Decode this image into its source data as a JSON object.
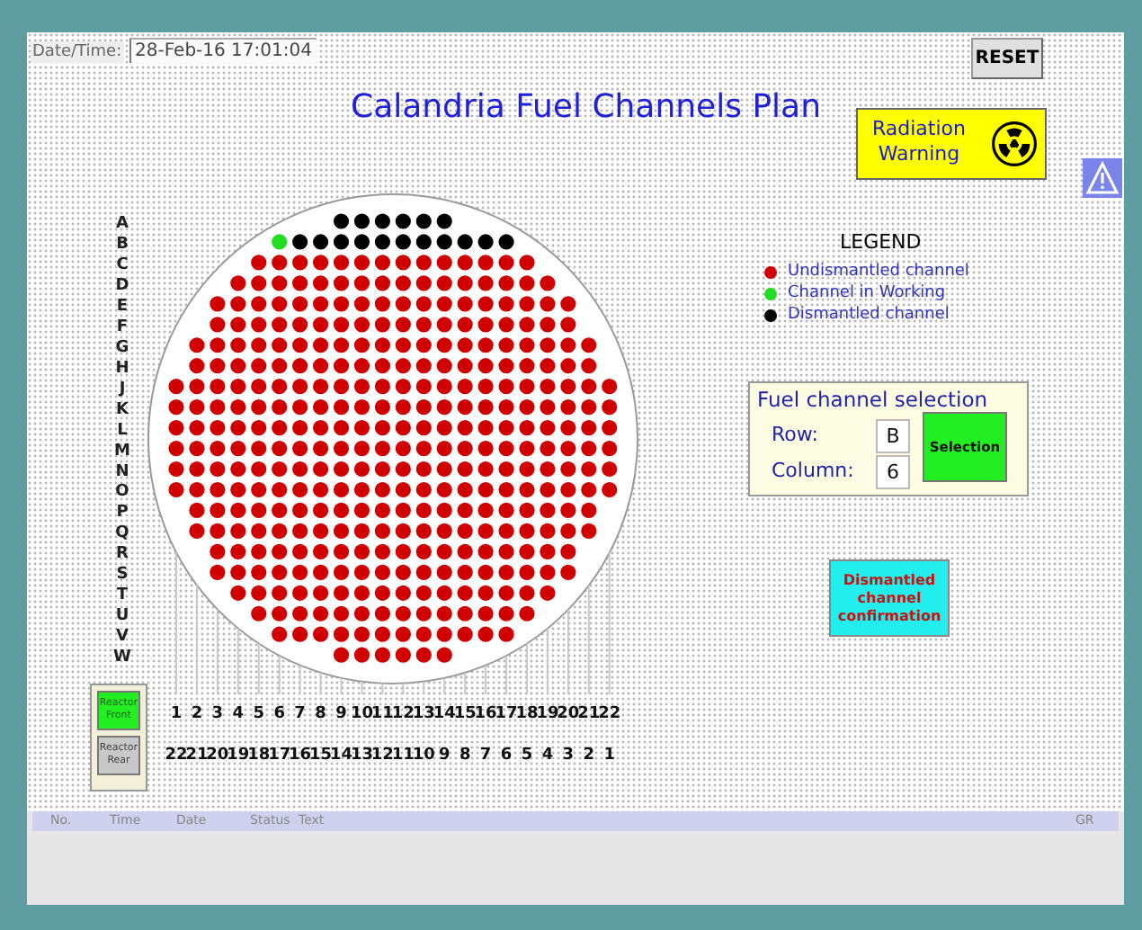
{
  "header": {
    "datetime_label": "Date/Time:",
    "datetime_value": "28-Feb-16 17:01:04",
    "reset_button": "RESET"
  },
  "title": "Calandria Fuel Channels Plan",
  "radiation_warning": {
    "text_line1": "Radiation",
    "text_line2": "Warning"
  },
  "grid": {
    "rows": [
      {
        "label": "A",
        "channels": [
          {
            "kind": "dismantled"
          },
          {
            "kind": "dismantled"
          },
          {
            "kind": "dismantled"
          },
          {
            "kind": "dismantled"
          },
          {
            "kind": "dismantled"
          },
          {
            "kind": "dismantled"
          }
        ]
      },
      {
        "label": "B",
        "channels": [
          {
            "kind": "working"
          },
          {
            "kind": "dismantled"
          },
          {
            "kind": "dismantled"
          },
          {
            "kind": "dismantled"
          },
          {
            "kind": "dismantled"
          },
          {
            "kind": "dismantled"
          },
          {
            "kind": "dismantled"
          },
          {
            "kind": "dismantled"
          },
          {
            "kind": "dismantled"
          },
          {
            "kind": "dismantled"
          },
          {
            "kind": "dismantled"
          },
          {
            "kind": "dismantled"
          }
        ]
      },
      {
        "label": "C",
        "channels": [
          {
            "kind": "intact"
          },
          {
            "kind": "intact"
          },
          {
            "kind": "intact"
          },
          {
            "kind": "intact"
          },
          {
            "kind": "intact"
          },
          {
            "kind": "intact"
          },
          {
            "kind": "intact"
          },
          {
            "kind": "intact"
          },
          {
            "kind": "intact"
          },
          {
            "kind": "intact"
          },
          {
            "kind": "intact"
          },
          {
            "kind": "intact"
          },
          {
            "kind": "intact"
          },
          {
            "kind": "intact"
          }
        ]
      },
      {
        "label": "D",
        "channels": [
          {
            "kind": "intact"
          },
          {
            "kind": "intact"
          },
          {
            "kind": "intact"
          },
          {
            "kind": "intact"
          },
          {
            "kind": "intact"
          },
          {
            "kind": "intact"
          },
          {
            "kind": "intact"
          },
          {
            "kind": "intact"
          },
          {
            "kind": "intact"
          },
          {
            "kind": "intact"
          },
          {
            "kind": "intact"
          },
          {
            "kind": "intact"
          },
          {
            "kind": "intact"
          },
          {
            "kind": "intact"
          },
          {
            "kind": "intact"
          },
          {
            "kind": "intact"
          }
        ]
      },
      {
        "label": "E",
        "channels": [
          {
            "kind": "intact"
          },
          {
            "kind": "intact"
          },
          {
            "kind": "intact"
          },
          {
            "kind": "intact"
          },
          {
            "kind": "intact"
          },
          {
            "kind": "intact"
          },
          {
            "kind": "intact"
          },
          {
            "kind": "intact"
          },
          {
            "kind": "intact"
          },
          {
            "kind": "intact"
          },
          {
            "kind": "intact"
          },
          {
            "kind": "intact"
          },
          {
            "kind": "intact"
          },
          {
            "kind": "intact"
          },
          {
            "kind": "intact"
          },
          {
            "kind": "intact"
          },
          {
            "kind": "intact"
          },
          {
            "kind": "intact"
          }
        ]
      },
      {
        "label": "F",
        "channels": [
          {
            "kind": "intact"
          },
          {
            "kind": "intact"
          },
          {
            "kind": "intact"
          },
          {
            "kind": "intact"
          },
          {
            "kind": "intact"
          },
          {
            "kind": "intact"
          },
          {
            "kind": "intact"
          },
          {
            "kind": "intact"
          },
          {
            "kind": "intact"
          },
          {
            "kind": "intact"
          },
          {
            "kind": "intact"
          },
          {
            "kind": "intact"
          },
          {
            "kind": "intact"
          },
          {
            "kind": "intact"
          },
          {
            "kind": "intact"
          },
          {
            "kind": "intact"
          },
          {
            "kind": "intact"
          },
          {
            "kind": "intact"
          }
        ]
      },
      {
        "label": "G",
        "channels": [
          {
            "kind": "intact"
          },
          {
            "kind": "intact"
          },
          {
            "kind": "intact"
          },
          {
            "kind": "intact"
          },
          {
            "kind": "intact"
          },
          {
            "kind": "intact"
          },
          {
            "kind": "intact"
          },
          {
            "kind": "intact"
          },
          {
            "kind": "intact"
          },
          {
            "kind": "intact"
          },
          {
            "kind": "intact"
          },
          {
            "kind": "intact"
          },
          {
            "kind": "intact"
          },
          {
            "kind": "intact"
          },
          {
            "kind": "intact"
          },
          {
            "kind": "intact"
          },
          {
            "kind": "intact"
          },
          {
            "kind": "intact"
          },
          {
            "kind": "intact"
          },
          {
            "kind": "intact"
          }
        ]
      },
      {
        "label": "H",
        "channels": [
          {
            "kind": "intact"
          },
          {
            "kind": "intact"
          },
          {
            "kind": "intact"
          },
          {
            "kind": "intact"
          },
          {
            "kind": "intact"
          },
          {
            "kind": "intact"
          },
          {
            "kind": "intact"
          },
          {
            "kind": "intact"
          },
          {
            "kind": "intact"
          },
          {
            "kind": "intact"
          },
          {
            "kind": "intact"
          },
          {
            "kind": "intact"
          },
          {
            "kind": "intact"
          },
          {
            "kind": "intact"
          },
          {
            "kind": "intact"
          },
          {
            "kind": "intact"
          },
          {
            "kind": "intact"
          },
          {
            "kind": "intact"
          },
          {
            "kind": "intact"
          },
          {
            "kind": "intact"
          }
        ]
      },
      {
        "label": "J",
        "channels": [
          {
            "kind": "intact"
          },
          {
            "kind": "intact"
          },
          {
            "kind": "intact"
          },
          {
            "kind": "intact"
          },
          {
            "kind": "intact"
          },
          {
            "kind": "intact"
          },
          {
            "kind": "intact"
          },
          {
            "kind": "intact"
          },
          {
            "kind": "intact"
          },
          {
            "kind": "intact"
          },
          {
            "kind": "intact"
          },
          {
            "kind": "intact"
          },
          {
            "kind": "intact"
          },
          {
            "kind": "intact"
          },
          {
            "kind": "intact"
          },
          {
            "kind": "intact"
          },
          {
            "kind": "intact"
          },
          {
            "kind": "intact"
          },
          {
            "kind": "intact"
          },
          {
            "kind": "intact"
          },
          {
            "kind": "intact"
          },
          {
            "kind": "intact"
          }
        ]
      },
      {
        "label": "K",
        "channels": [
          {
            "kind": "intact"
          },
          {
            "kind": "intact"
          },
          {
            "kind": "intact"
          },
          {
            "kind": "intact"
          },
          {
            "kind": "intact"
          },
          {
            "kind": "intact"
          },
          {
            "kind": "intact"
          },
          {
            "kind": "intact"
          },
          {
            "kind": "intact"
          },
          {
            "kind": "intact"
          },
          {
            "kind": "intact"
          },
          {
            "kind": "intact"
          },
          {
            "kind": "intact"
          },
          {
            "kind": "intact"
          },
          {
            "kind": "intact"
          },
          {
            "kind": "intact"
          },
          {
            "kind": "intact"
          },
          {
            "kind": "intact"
          },
          {
            "kind": "intact"
          },
          {
            "kind": "intact"
          },
          {
            "kind": "intact"
          },
          {
            "kind": "intact"
          }
        ]
      },
      {
        "label": "L",
        "channels": [
          {
            "kind": "intact"
          },
          {
            "kind": "intact"
          },
          {
            "kind": "intact"
          },
          {
            "kind": "intact"
          },
          {
            "kind": "intact"
          },
          {
            "kind": "intact"
          },
          {
            "kind": "intact"
          },
          {
            "kind": "intact"
          },
          {
            "kind": "intact"
          },
          {
            "kind": "intact"
          },
          {
            "kind": "intact"
          },
          {
            "kind": "intact"
          },
          {
            "kind": "intact"
          },
          {
            "kind": "intact"
          },
          {
            "kind": "intact"
          },
          {
            "kind": "intact"
          },
          {
            "kind": "intact"
          },
          {
            "kind": "intact"
          },
          {
            "kind": "intact"
          },
          {
            "kind": "intact"
          },
          {
            "kind": "intact"
          },
          {
            "kind": "intact"
          }
        ]
      },
      {
        "label": "M",
        "channels": [
          {
            "kind": "intact"
          },
          {
            "kind": "intact"
          },
          {
            "kind": "intact"
          },
          {
            "kind": "intact"
          },
          {
            "kind": "intact"
          },
          {
            "kind": "intact"
          },
          {
            "kind": "intact"
          },
          {
            "kind": "intact"
          },
          {
            "kind": "intact"
          },
          {
            "kind": "intact"
          },
          {
            "kind": "intact"
          },
          {
            "kind": "intact"
          },
          {
            "kind": "intact"
          },
          {
            "kind": "intact"
          },
          {
            "kind": "intact"
          },
          {
            "kind": "intact"
          },
          {
            "kind": "intact"
          },
          {
            "kind": "intact"
          },
          {
            "kind": "intact"
          },
          {
            "kind": "intact"
          },
          {
            "kind": "intact"
          },
          {
            "kind": "intact"
          }
        ]
      },
      {
        "label": "N",
        "channels": [
          {
            "kind": "intact"
          },
          {
            "kind": "intact"
          },
          {
            "kind": "intact"
          },
          {
            "kind": "intact"
          },
          {
            "kind": "intact"
          },
          {
            "kind": "intact"
          },
          {
            "kind": "intact"
          },
          {
            "kind": "intact"
          },
          {
            "kind": "intact"
          },
          {
            "kind": "intact"
          },
          {
            "kind": "intact"
          },
          {
            "kind": "intact"
          },
          {
            "kind": "intact"
          },
          {
            "kind": "intact"
          },
          {
            "kind": "intact"
          },
          {
            "kind": "intact"
          },
          {
            "kind": "intact"
          },
          {
            "kind": "intact"
          },
          {
            "kind": "intact"
          },
          {
            "kind": "intact"
          },
          {
            "kind": "intact"
          },
          {
            "kind": "intact"
          }
        ]
      },
      {
        "label": "O",
        "channels": [
          {
            "kind": "intact"
          },
          {
            "kind": "intact"
          },
          {
            "kind": "intact"
          },
          {
            "kind": "intact"
          },
          {
            "kind": "intact"
          },
          {
            "kind": "intact"
          },
          {
            "kind": "intact"
          },
          {
            "kind": "intact"
          },
          {
            "kind": "intact"
          },
          {
            "kind": "intact"
          },
          {
            "kind": "intact"
          },
          {
            "kind": "intact"
          },
          {
            "kind": "intact"
          },
          {
            "kind": "intact"
          },
          {
            "kind": "intact"
          },
          {
            "kind": "intact"
          },
          {
            "kind": "intact"
          },
          {
            "kind": "intact"
          },
          {
            "kind": "intact"
          },
          {
            "kind": "intact"
          },
          {
            "kind": "intact"
          },
          {
            "kind": "intact"
          }
        ]
      },
      {
        "label": "P",
        "channels": [
          {
            "kind": "intact"
          },
          {
            "kind": "intact"
          },
          {
            "kind": "intact"
          },
          {
            "kind": "intact"
          },
          {
            "kind": "intact"
          },
          {
            "kind": "intact"
          },
          {
            "kind": "intact"
          },
          {
            "kind": "intact"
          },
          {
            "kind": "intact"
          },
          {
            "kind": "intact"
          },
          {
            "kind": "intact"
          },
          {
            "kind": "intact"
          },
          {
            "kind": "intact"
          },
          {
            "kind": "intact"
          },
          {
            "kind": "intact"
          },
          {
            "kind": "intact"
          },
          {
            "kind": "intact"
          },
          {
            "kind": "intact"
          },
          {
            "kind": "intact"
          },
          {
            "kind": "intact"
          }
        ]
      },
      {
        "label": "Q",
        "channels": [
          {
            "kind": "intact"
          },
          {
            "kind": "intact"
          },
          {
            "kind": "intact"
          },
          {
            "kind": "intact"
          },
          {
            "kind": "intact"
          },
          {
            "kind": "intact"
          },
          {
            "kind": "intact"
          },
          {
            "kind": "intact"
          },
          {
            "kind": "intact"
          },
          {
            "kind": "intact"
          },
          {
            "kind": "intact"
          },
          {
            "kind": "intact"
          },
          {
            "kind": "intact"
          },
          {
            "kind": "intact"
          },
          {
            "kind": "intact"
          },
          {
            "kind": "intact"
          },
          {
            "kind": "intact"
          },
          {
            "kind": "intact"
          },
          {
            "kind": "intact"
          },
          {
            "kind": "intact"
          }
        ]
      },
      {
        "label": "R",
        "channels": [
          {
            "kind": "intact"
          },
          {
            "kind": "intact"
          },
          {
            "kind": "intact"
          },
          {
            "kind": "intact"
          },
          {
            "kind": "intact"
          },
          {
            "kind": "intact"
          },
          {
            "kind": "intact"
          },
          {
            "kind": "intact"
          },
          {
            "kind": "intact"
          },
          {
            "kind": "intact"
          },
          {
            "kind": "intact"
          },
          {
            "kind": "intact"
          },
          {
            "kind": "intact"
          },
          {
            "kind": "intact"
          },
          {
            "kind": "intact"
          },
          {
            "kind": "intact"
          },
          {
            "kind": "intact"
          },
          {
            "kind": "intact"
          }
        ]
      },
      {
        "label": "S",
        "channels": [
          {
            "kind": "intact"
          },
          {
            "kind": "intact"
          },
          {
            "kind": "intact"
          },
          {
            "kind": "intact"
          },
          {
            "kind": "intact"
          },
          {
            "kind": "intact"
          },
          {
            "kind": "intact"
          },
          {
            "kind": "intact"
          },
          {
            "kind": "intact"
          },
          {
            "kind": "intact"
          },
          {
            "kind": "intact"
          },
          {
            "kind": "intact"
          },
          {
            "kind": "intact"
          },
          {
            "kind": "intact"
          },
          {
            "kind": "intact"
          },
          {
            "kind": "intact"
          },
          {
            "kind": "intact"
          },
          {
            "kind": "intact"
          }
        ]
      },
      {
        "label": "T",
        "channels": [
          {
            "kind": "intact"
          },
          {
            "kind": "intact"
          },
          {
            "kind": "intact"
          },
          {
            "kind": "intact"
          },
          {
            "kind": "intact"
          },
          {
            "kind": "intact"
          },
          {
            "kind": "intact"
          },
          {
            "kind": "intact"
          },
          {
            "kind": "intact"
          },
          {
            "kind": "intact"
          },
          {
            "kind": "intact"
          },
          {
            "kind": "intact"
          },
          {
            "kind": "intact"
          },
          {
            "kind": "intact"
          },
          {
            "kind": "intact"
          },
          {
            "kind": "intact"
          }
        ]
      },
      {
        "label": "U",
        "channels": [
          {
            "kind": "intact"
          },
          {
            "kind": "intact"
          },
          {
            "kind": "intact"
          },
          {
            "kind": "intact"
          },
          {
            "kind": "intact"
          },
          {
            "kind": "intact"
          },
          {
            "kind": "intact"
          },
          {
            "kind": "intact"
          },
          {
            "kind": "intact"
          },
          {
            "kind": "intact"
          },
          {
            "kind": "intact"
          },
          {
            "kind": "intact"
          },
          {
            "kind": "intact"
          },
          {
            "kind": "intact"
          }
        ]
      },
      {
        "label": "V",
        "channels": [
          {
            "kind": "intact"
          },
          {
            "kind": "intact"
          },
          {
            "kind": "intact"
          },
          {
            "kind": "intact"
          },
          {
            "kind": "intact"
          },
          {
            "kind": "intact"
          },
          {
            "kind": "intact"
          },
          {
            "kind": "intact"
          },
          {
            "kind": "intact"
          },
          {
            "kind": "intact"
          },
          {
            "kind": "intact"
          },
          {
            "kind": "intact"
          }
        ]
      },
      {
        "label": "W",
        "channels": [
          {
            "kind": "intact"
          },
          {
            "kind": "intact"
          },
          {
            "kind": "intact"
          },
          {
            "kind": "intact"
          },
          {
            "kind": "intact"
          },
          {
            "kind": "intact"
          }
        ]
      }
    ],
    "front_numbers": [
      "1",
      "2",
      "3",
      "4",
      "5",
      "6",
      "7",
      "8",
      "9",
      "10",
      "11",
      "12",
      "13",
      "14",
      "15",
      "16",
      "17",
      "18",
      "19",
      "20",
      "21",
      "22"
    ],
    "rear_numbers": [
      "22",
      "21",
      "20",
      "19",
      "18",
      "17",
      "16",
      "15",
      "14",
      "13",
      "12",
      "11",
      "10",
      "9",
      "8",
      "7",
      "6",
      "5",
      "4",
      "3",
      "2",
      "1"
    ]
  },
  "view_buttons": [
    {
      "line1": "Reactor",
      "line2": "Front",
      "selected": true
    },
    {
      "line1": "Reactor",
      "line2": "Rear",
      "selected": false
    }
  ],
  "legend": {
    "title": "LEGEND",
    "items": [
      {
        "label": "Undismantled channel",
        "color": "#d00000"
      },
      {
        "label": "Channel in Working",
        "color": "#22dd22"
      },
      {
        "label": "Dismantled channel",
        "color": "#000000"
      }
    ]
  },
  "selection": {
    "title": "Fuel channel selection",
    "row_label": "Row:",
    "row_value": "B",
    "column_label": "Column:",
    "column_value": "6",
    "button": "Selection"
  },
  "confirm_button": {
    "line1": "Dismantled",
    "line2": "channel",
    "line3": "confirmation"
  },
  "alarm_table": {
    "columns": [
      "No.",
      "Time",
      "Date",
      "Status",
      "Text",
      "GR"
    ]
  }
}
